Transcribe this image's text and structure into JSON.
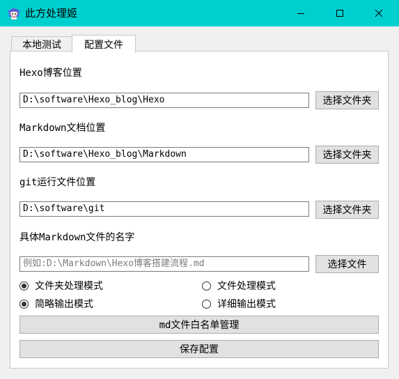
{
  "window": {
    "title": "此方处理姬"
  },
  "tabs": [
    {
      "label": "本地测试",
      "active": false
    },
    {
      "label": "配置文件",
      "active": true
    }
  ],
  "config": {
    "hexo_label": "Hexo博客位置",
    "hexo_value": "D:\\software\\Hexo_blog\\Hexo",
    "markdown_label": "Markdown文档位置",
    "markdown_value": "D:\\software\\Hexo_blog\\Markdown",
    "git_label": "git运行文件位置",
    "git_value": "D:\\software\\git",
    "mdfile_label": "具体Markdown文件的名字",
    "mdfile_placeholder": "例如:D:\\Markdown\\Hexo博客搭建流程.md",
    "browse_folder_label": "选择文件夹",
    "browse_file_label": "选择文件"
  },
  "modes": {
    "folder_mode": {
      "label": "文件夹处理模式",
      "checked": true
    },
    "file_mode": {
      "label": "文件处理模式",
      "checked": false
    },
    "brief_output": {
      "label": "简略输出模式",
      "checked": true
    },
    "verbose_output": {
      "label": "详细输出模式",
      "checked": false
    }
  },
  "buttons": {
    "whitelist": "md文件白名单管理",
    "save": "保存配置"
  },
  "icons": {
    "app": "anime-character-icon",
    "minimize": "minimize-icon",
    "maximize": "maximize-icon",
    "close": "close-icon"
  },
  "colors": {
    "titlebar": "#00cfcf"
  }
}
